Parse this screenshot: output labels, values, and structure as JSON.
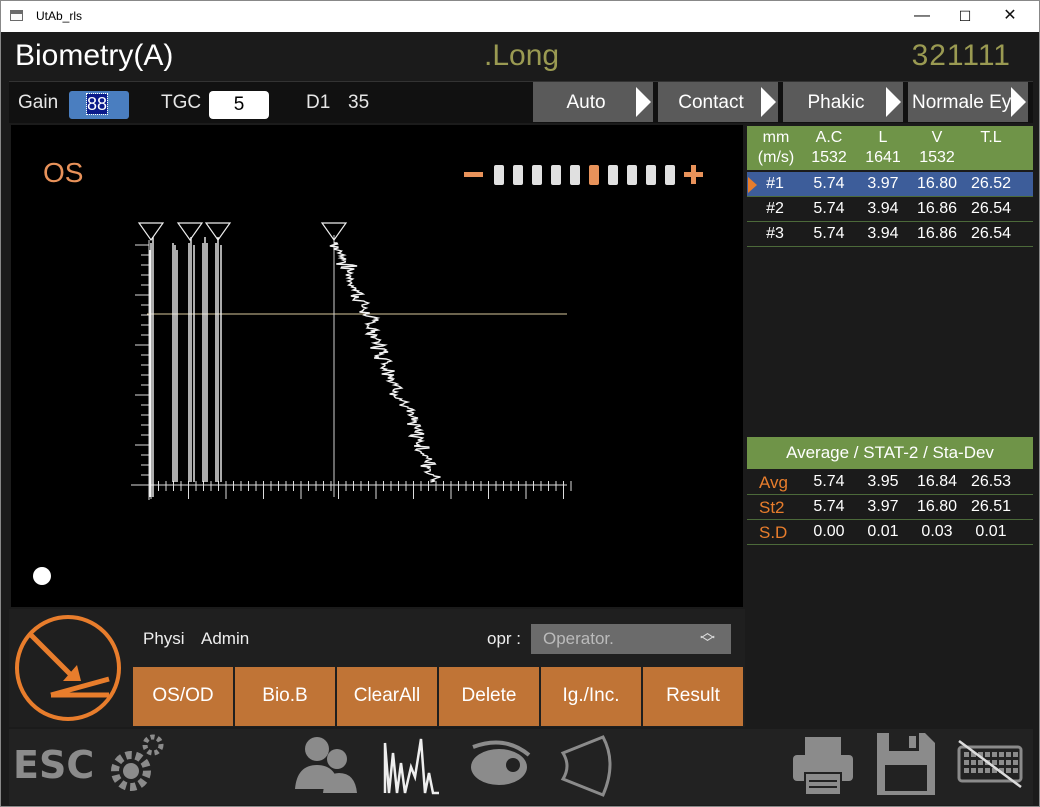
{
  "window": {
    "title": "UtAb_rls",
    "min": "—",
    "max": "☐",
    "close": "✕"
  },
  "header": {
    "title": "Biometry(A)",
    "mode": ".Long",
    "patient_id": "321111"
  },
  "controls": {
    "gain_label": "Gain",
    "gain_value": "88",
    "tgc_label": "TGC",
    "tgc_value": "5",
    "d1_label": "D1",
    "d1_value": "35",
    "tabs": [
      "Auto",
      "Contact",
      "Phakic",
      "Normale Ey"
    ]
  },
  "plot": {
    "eye": "OS",
    "minus": "−",
    "plus": "+",
    "zoom_level": 6,
    "zoom_steps": 10
  },
  "measure_table": {
    "headers": [
      {
        "top": "mm",
        "bottom": "(m/s)"
      },
      {
        "top": "A.C",
        "bottom": "1532"
      },
      {
        "top": "L",
        "bottom": "1641"
      },
      {
        "top": "V",
        "bottom": "1532"
      },
      {
        "top": "T.L",
        "bottom": ""
      }
    ],
    "rows": [
      [
        "#1",
        "5.74",
        "3.97",
        "16.80",
        "26.52"
      ],
      [
        "#2",
        "5.74",
        "3.94",
        "16.86",
        "26.54"
      ],
      [
        "#3",
        "5.74",
        "3.94",
        "16.86",
        "26.54"
      ]
    ],
    "selected_row": 0
  },
  "stats": {
    "title": "Average / STAT-2 / Sta-Dev",
    "rows": [
      [
        "Avg",
        "5.74",
        "3.95",
        "16.84",
        "26.53"
      ],
      [
        "St2",
        "5.74",
        "3.97",
        "16.80",
        "26.51"
      ],
      [
        "S.D",
        "0.00",
        "0.01",
        "0.03",
        "0.01"
      ]
    ]
  },
  "lower": {
    "physi_label": "Physi",
    "physi_value": "Admin",
    "opr_label": "opr :",
    "opr_placeholder": "Operator.",
    "buttons": [
      "OS/OD",
      "Bio.B",
      "ClearAll",
      "Delete",
      "Ig./Inc.",
      "Result"
    ]
  },
  "footer": {
    "esc": "ESC"
  },
  "colors": {
    "accent_orange": "#c07436",
    "header_green": "#6f9448",
    "select_blue": "#3d5d9a",
    "olive_text": "#9a9a52"
  }
}
